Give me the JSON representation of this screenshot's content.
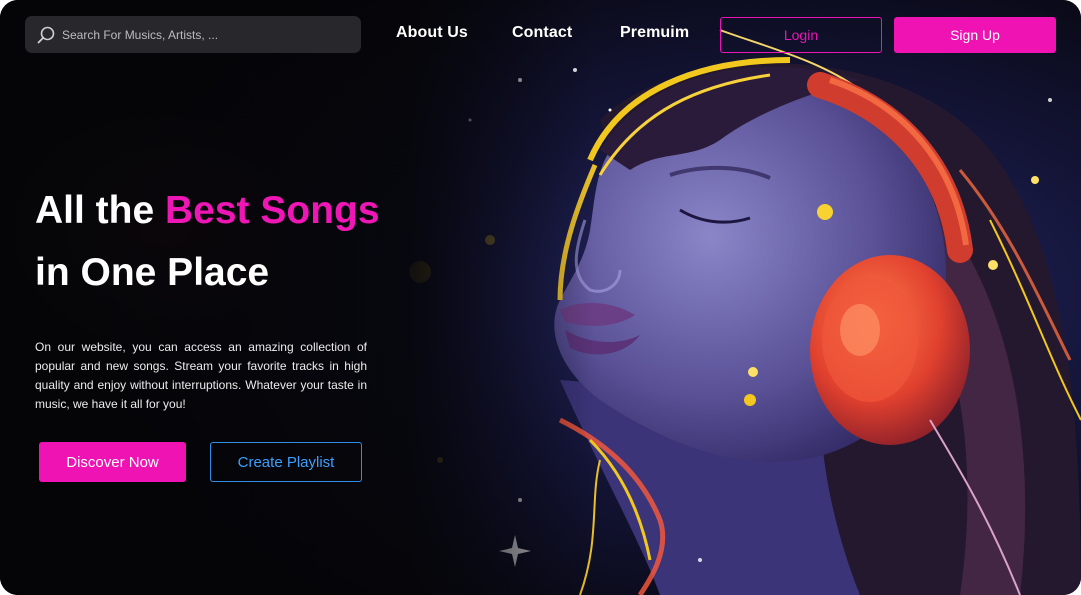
{
  "search": {
    "placeholder": "Search For Musics, Artists, ...",
    "icon": "search-icon"
  },
  "nav": {
    "links": [
      {
        "label": "About Us"
      },
      {
        "label": "Contact"
      },
      {
        "label": "Premuim"
      }
    ],
    "login_label": "Login",
    "signup_label": "Sign Up"
  },
  "hero": {
    "headline_part1": "All the ",
    "headline_accent": "Best Songs",
    "headline_line2": "in One Place",
    "description": "On our website, you can access an amazing collection of popular and new songs. Stream your favorite tracks in high quality and enjoy without interruptions. Whatever your taste in music, we have it all for you!",
    "primary_cta": "Discover Now",
    "secondary_cta": "Create Playlist"
  },
  "colors": {
    "accent": "#ee13b2",
    "secondary": "#2f8fe6",
    "background": "#07070d"
  }
}
